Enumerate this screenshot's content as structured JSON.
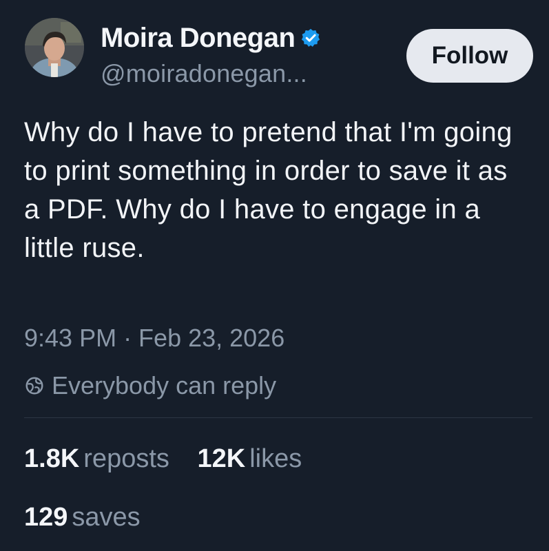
{
  "author": {
    "display_name": "Moira Donegan",
    "handle": "@moiradonegan...",
    "verified": true
  },
  "follow_label": "Follow",
  "tweet": {
    "text": "Why do I have to pretend that I'm going to print something in order to save it as a PDF. Why do I have to engage in a little ruse.",
    "timestamp": "9:43 PM · Feb 23, 2026",
    "reply_setting": "Everybody can reply"
  },
  "stats": {
    "reposts_count": "1.8K",
    "reposts_label": "reposts",
    "likes_count": "12K",
    "likes_label": "likes",
    "saves_count": "129",
    "saves_label": "saves"
  },
  "icons": {
    "verified": "verified-badge-icon",
    "reply": "globe-reply-icon"
  },
  "colors": {
    "background": "#161e2a",
    "text_primary": "#f2f4f7",
    "text_secondary": "#8b98a8",
    "verified_blue": "#1d9bf0",
    "follow_bg": "#e6e9ef"
  }
}
